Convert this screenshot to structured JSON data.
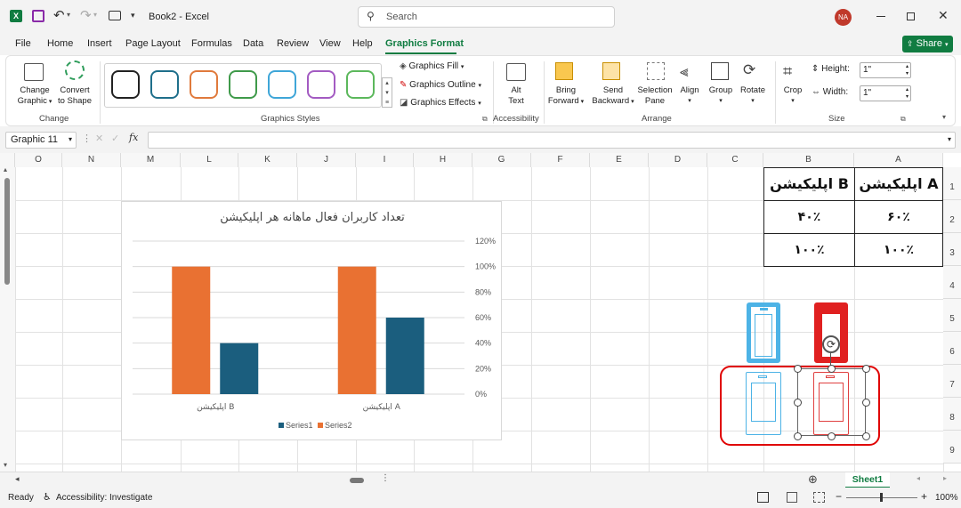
{
  "titlebar": {
    "workbook_name": "Book2",
    "separator": "-",
    "app_name": "Excel",
    "search_placeholder": "Search",
    "user_initials": "NA",
    "qat_icons": [
      "excel-logo-icon",
      "save-icon",
      "undo-icon",
      "redo-icon",
      "print-icon",
      "qat-more-icon"
    ]
  },
  "tabs": [
    {
      "label": "File"
    },
    {
      "label": "Home"
    },
    {
      "label": "Insert"
    },
    {
      "label": "Page Layout"
    },
    {
      "label": "Formulas"
    },
    {
      "label": "Data"
    },
    {
      "label": "Review"
    },
    {
      "label": "View"
    },
    {
      "label": "Help"
    },
    {
      "label": "Graphics Format",
      "active": true
    }
  ],
  "share_label": "Share",
  "ribbon": {
    "change": {
      "change_graphic_line1": "Change",
      "change_graphic_line2": "Graphic",
      "convert_line1": "Convert",
      "convert_line2": "to Shape",
      "group": "Change"
    },
    "styles": {
      "group": "Graphics Styles",
      "swatch_colors": [
        "#222222",
        "#1f6f8b",
        "#e07a3c",
        "#3f9a4a",
        "#3fa6d8",
        "#a35bc2",
        "#5cb85c"
      ],
      "fill": "Graphics Fill",
      "outline": "Graphics Outline",
      "effects": "Graphics Effects"
    },
    "accessibility": {
      "alt_line1": "Alt",
      "alt_line2": "Text",
      "group": "Accessibility"
    },
    "arrange": {
      "bring_line1": "Bring",
      "bring_line2": "Forward",
      "send_line1": "Send",
      "send_line2": "Backward",
      "selection_line1": "Selection",
      "selection_line2": "Pane",
      "align": "Align",
      "group_btn": "Group",
      "rotate": "Rotate",
      "group": "Arrange"
    },
    "size": {
      "crop": "Crop",
      "height_label": "Height:",
      "height_value": "1\"",
      "width_label": "Width:",
      "width_value": "1\"",
      "group": "Size"
    }
  },
  "formula": {
    "name_box": "Graphic 11",
    "fx": "fx",
    "value": ""
  },
  "columns": [
    "O",
    "N",
    "M",
    "L",
    "K",
    "J",
    "I",
    "H",
    "G",
    "F",
    "E",
    "D",
    "C",
    "B",
    "A"
  ],
  "rows": [
    "1",
    "2",
    "3",
    "4",
    "5",
    "6",
    "7",
    "8",
    "9"
  ],
  "table": {
    "header_a": "اپلیکیشن A",
    "header_b": "اپلیکیشن B",
    "r2_a": "۶۰٪",
    "r2_b": "۴۰٪",
    "r3_a": "۱۰۰٪",
    "r3_b": "۱۰۰٪"
  },
  "chart_data": {
    "type": "bar",
    "title": "تعداد کاربران فعال ماهانه هر اپلیکیشن",
    "categories": [
      "اپلیکیشن B",
      "اپلیکیشن A"
    ],
    "series": [
      {
        "name": "Series1",
        "values": [
          0.4,
          0.6
        ],
        "color": "#1b5e7e"
      },
      {
        "name": "Series2",
        "values": [
          1.0,
          1.0
        ],
        "color": "#e97132"
      }
    ],
    "ylim": [
      0,
      1.2
    ],
    "yticks": [
      "0%",
      "20%",
      "40%",
      "60%",
      "80%",
      "100%",
      "120%"
    ],
    "grid": true,
    "legend_position": "bottom",
    "y_axis_side": "right"
  },
  "sheet_tab": "Sheet1",
  "status": {
    "ready": "Ready",
    "accessibility": "Accessibility: Investigate",
    "zoom": "100%"
  },
  "colors": {
    "accent": "#107c41",
    "selection_red": "#e00000",
    "phone_blue": "#4db3e6",
    "phone_red": "#e02020"
  }
}
